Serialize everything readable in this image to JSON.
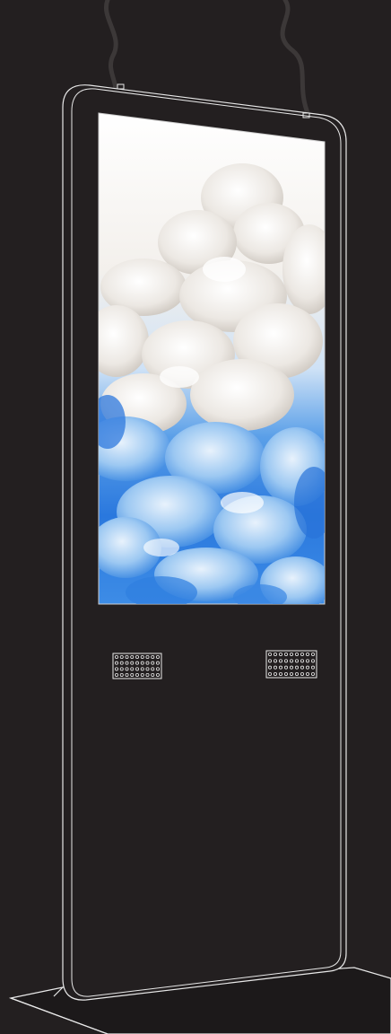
{
  "scene": {
    "subject": "floor-standing-digital-signage-kiosk",
    "background_color": "#231f20",
    "outline_color": "#e8e8e8",
    "display_content": "white-and-blue-ink-smoke-cloud",
    "colors": {
      "smoke_white": "#f2f0ee",
      "smoke_shadow": "#d9d4ce",
      "ink_blue": "#2f7fe0",
      "ink_light_blue": "#8ec4f4",
      "screen_top": "#ffffff"
    },
    "speaker_grilles": 2
  }
}
